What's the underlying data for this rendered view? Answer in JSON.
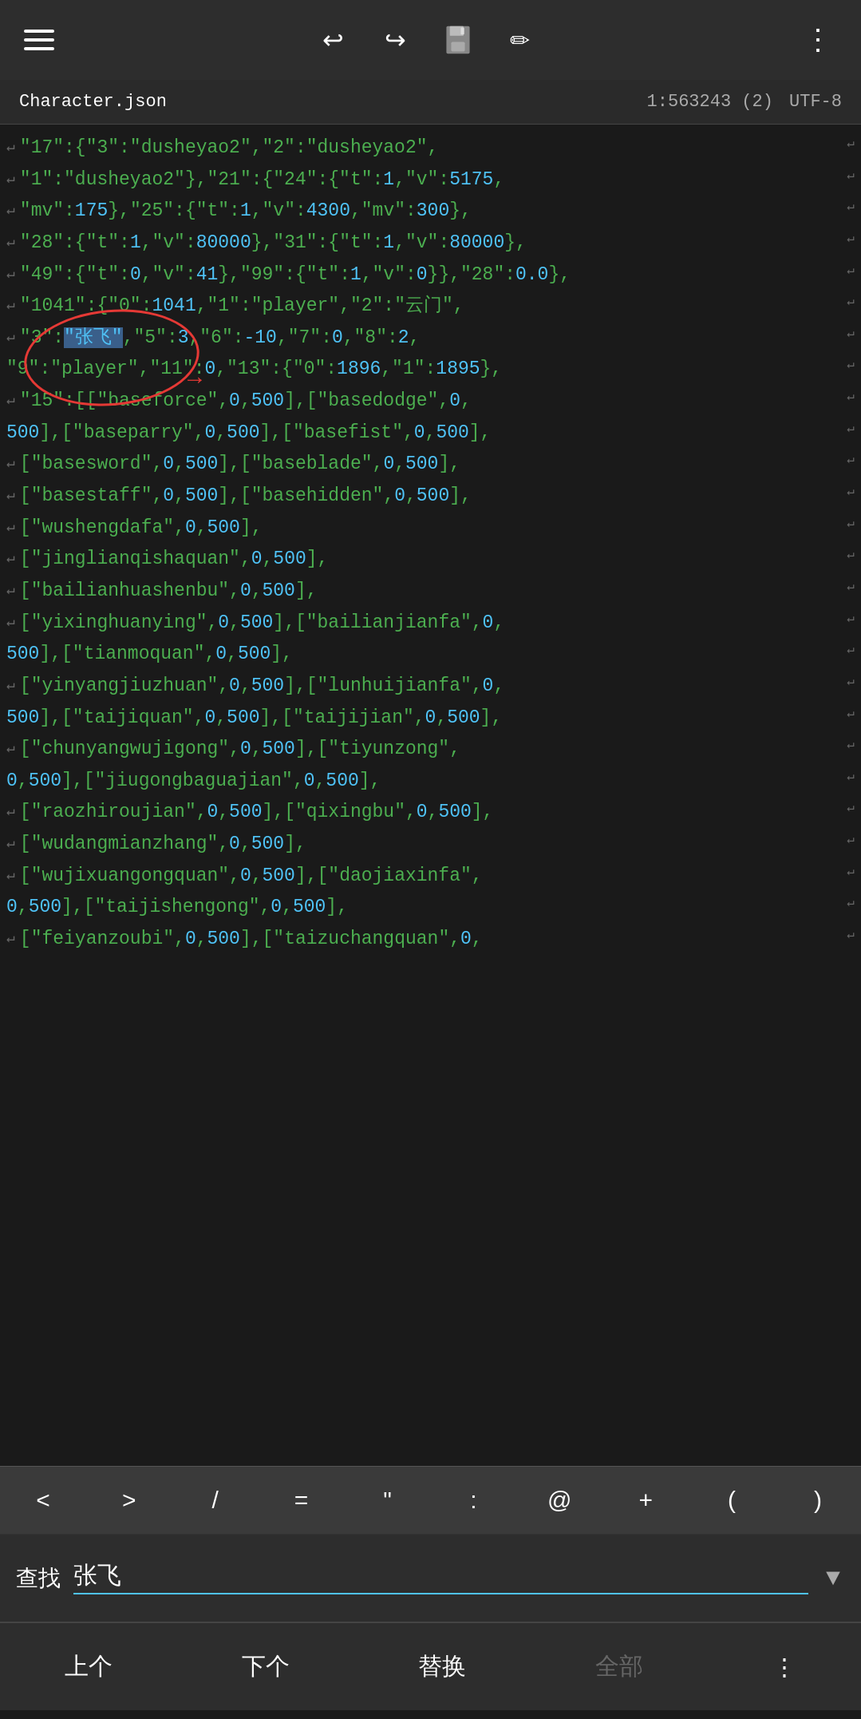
{
  "toolbar": {
    "undo_label": "↩",
    "redo_label": "↪",
    "more_label": "⋮"
  },
  "file_bar": {
    "filename": "Character.json",
    "position": "1:563243 (2)",
    "encoding": "UTF-8"
  },
  "code_lines": [
    {
      "id": 1,
      "arrow": true,
      "content": "\"17\":{\"3\":\"dusheyao2\",\"2\":\"dusheyao2\",",
      "has_wrap": true
    },
    {
      "id": 2,
      "arrow": true,
      "content": "\"1\":\"dusheyao2\"},\"21\":{\"24\":{\"t\":1,\"v\":5175,",
      "has_wrap": true,
      "nums": [
        "5175"
      ]
    },
    {
      "id": 3,
      "arrow": true,
      "content": "\"mv\":175},\"25\":{\"t\":1,\"v\":4300,\"mv\":300},",
      "has_wrap": true,
      "nums": [
        "175",
        "4300",
        "300"
      ]
    },
    {
      "id": 4,
      "arrow": true,
      "content": "\"28\":{\"t\":1,\"v\":80000},\"31\":{\"t\":1,\"v\":80000},",
      "has_wrap": true,
      "nums": [
        "80000",
        "80000"
      ]
    },
    {
      "id": 5,
      "arrow": true,
      "content": "\"49\":{\"t\":0,\"v\":41},\"99\":{\"t\":1,\"v\":0}},\"28\":0.0},",
      "has_wrap": true,
      "nums": [
        "41",
        "0",
        "0.0"
      ]
    },
    {
      "id": 6,
      "arrow": true,
      "content": "\"1041\":{\"0\":1041,\"1\":\"player\",\"2\":\"云门\",",
      "has_wrap": true,
      "nums": [
        "1041"
      ]
    },
    {
      "id": 7,
      "arrow": true,
      "content": "\"3\":\"张飞\",\"5\":3,\"6\":-10,\"7\":0,\"8\":2,",
      "has_wrap": true,
      "highlight": "张飞",
      "nums": [
        "3",
        "-10",
        "0",
        "2"
      ]
    },
    {
      "id": 8,
      "arrow": false,
      "content": "\"9\":\"player\",\"11\":0,\"13\":{\"0\":1896,\"1\":1895},",
      "has_wrap": true,
      "circle": true,
      "nums": [
        "0",
        "1896",
        "1895"
      ]
    },
    {
      "id": 9,
      "arrow": true,
      "content": "\"15\":[[\"baseforce\",0,500],[\"basedodge\",0,",
      "has_wrap": true,
      "nums": [
        "0",
        "500",
        "0"
      ]
    },
    {
      "id": 10,
      "arrow": false,
      "content": "500],[\"baseparry\",0,500],[\"basefist\",0,500],",
      "has_wrap": true,
      "nums": [
        "500",
        "0",
        "500",
        "0",
        "500"
      ]
    },
    {
      "id": 11,
      "arrow": true,
      "content": "[\"basesword\",0,500],[\"baseblade\",0,500],",
      "has_wrap": true,
      "nums": [
        "0",
        "500",
        "0",
        "500"
      ]
    },
    {
      "id": 12,
      "arrow": true,
      "content": "[\"basestaff\",0,500],[\"basehidden\",0,500],",
      "has_wrap": true,
      "nums": [
        "0",
        "500",
        "0",
        "500"
      ]
    },
    {
      "id": 13,
      "arrow": true,
      "content": "[\"wushengdafa\",0,500],",
      "has_wrap": true,
      "nums": [
        "0",
        "500"
      ]
    },
    {
      "id": 14,
      "arrow": true,
      "content": "[\"jinglianqishaquan\",0,500],",
      "has_wrap": true,
      "nums": [
        "0",
        "500"
      ]
    },
    {
      "id": 15,
      "arrow": true,
      "content": "[\"bailianhuashenbu\",0,500],",
      "has_wrap": true,
      "nums": [
        "0",
        "500"
      ]
    },
    {
      "id": 16,
      "arrow": true,
      "content": "[\"yixinghuanying\",0,500],[\"bailianjianfa\",0,",
      "has_wrap": true,
      "nums": [
        "0",
        "500",
        "0"
      ]
    },
    {
      "id": 17,
      "arrow": false,
      "content": "500],[\"tianmoquan\",0,500],",
      "has_wrap": true,
      "nums": [
        "500",
        "0",
        "500"
      ]
    },
    {
      "id": 18,
      "arrow": true,
      "content": "[\"yinyangjiuzhuan\",0,500],[\"lunhuijianfa\",0,",
      "has_wrap": true,
      "nums": [
        "0",
        "500",
        "0"
      ]
    },
    {
      "id": 19,
      "arrow": false,
      "content": "500],[\"taijiquan\",0,500],[\"taijijian\",0,500],",
      "has_wrap": true,
      "nums": [
        "500",
        "0",
        "500",
        "0",
        "500"
      ]
    },
    {
      "id": 20,
      "arrow": true,
      "content": "[\"chunyangwujigong\",0,500],[\"tiyunzong\",",
      "has_wrap": true,
      "nums": [
        "0",
        "500"
      ]
    },
    {
      "id": 21,
      "arrow": false,
      "content": "0,500],[\"jiugongbaguajian\",0,500],",
      "has_wrap": true,
      "nums": [
        "0",
        "500",
        "0",
        "500"
      ]
    },
    {
      "id": 22,
      "arrow": true,
      "content": "[\"raozhiroujian\",0,500],[\"qixingbu\",0,500],",
      "has_wrap": true,
      "nums": [
        "0",
        "500",
        "0",
        "500"
      ]
    },
    {
      "id": 23,
      "arrow": true,
      "content": "[\"wudangmianzhang\",0,500],",
      "has_wrap": true,
      "nums": [
        "0",
        "500"
      ]
    },
    {
      "id": 24,
      "arrow": true,
      "content": "[\"wujixuangongquan\",0,500],[\"daojiaxinfa\",",
      "has_wrap": true,
      "nums": [
        "0",
        "500"
      ]
    },
    {
      "id": 25,
      "arrow": false,
      "content": "0,500],[\"taijishengong\",0,500],",
      "has_wrap": true,
      "nums": [
        "0",
        "500",
        "0",
        "500"
      ]
    },
    {
      "id": 26,
      "arrow": true,
      "content": "[\"feiyanzoubi\",0,500],[\"taizuchangquan\",0,",
      "has_wrap": true,
      "nums": [
        "0",
        "500",
        "0"
      ]
    }
  ],
  "sym_bar": {
    "keys": [
      "<",
      ">",
      "/",
      "=",
      "\"",
      ":",
      "@",
      "+",
      "(",
      ")"
    ]
  },
  "search_bar": {
    "label": "查找",
    "value": "张飞",
    "placeholder": ""
  },
  "action_bar": {
    "prev_label": "上个",
    "next_label": "下个",
    "replace_label": "替换",
    "all_label": "全部",
    "more_label": "⋮"
  }
}
